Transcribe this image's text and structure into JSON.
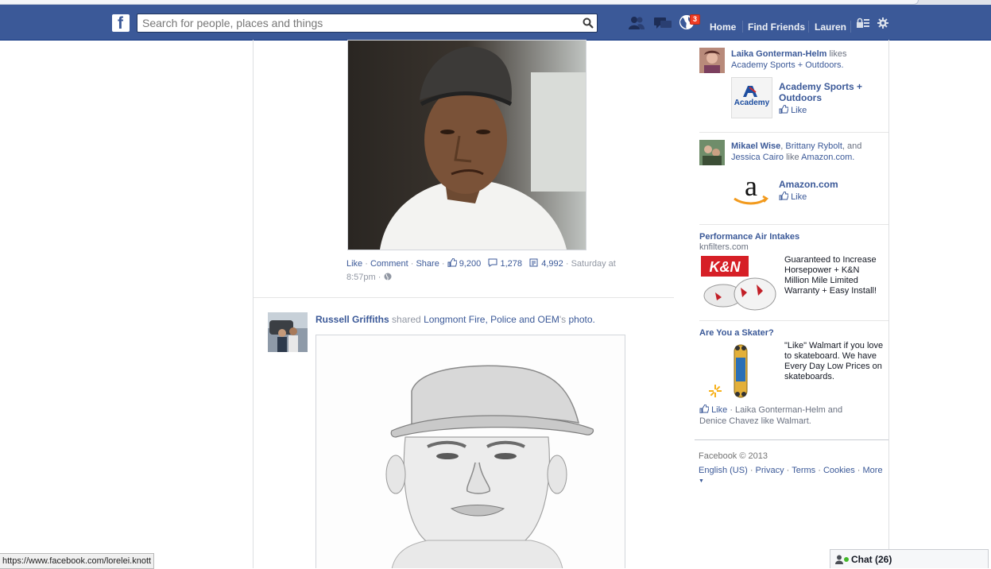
{
  "topbar": {
    "search_placeholder": "Search for people, places and things",
    "notifications_count": "3",
    "nav": {
      "home": "Home",
      "find_friends": "Find Friends",
      "profile": "Lauren"
    }
  },
  "story1": {
    "actions": {
      "like": "Like",
      "comment": "Comment",
      "share": "Share",
      "likes_count": "9,200",
      "comments_count": "1,278",
      "shares_count": "4,992",
      "time": "Saturday at 8:57pm"
    }
  },
  "story2": {
    "author": "Russell Griffiths",
    "verb": "shared",
    "page": "Longmont Fire, Police and OEM",
    "possessive": "'s",
    "object": "photo."
  },
  "sidebar": {
    "item1": {
      "name": "Laika Gonterman-Helm",
      "verb": "likes",
      "page": "Academy Sports + Outdoors.",
      "page_title": "Academy Sports + Outdoors",
      "thumb_text": "Academy",
      "like": "Like"
    },
    "item2": {
      "name": "Mikael Wise",
      "sep": ",",
      "name2": "Brittany Rybolt",
      "and": ", and",
      "name3": "Jessica Cairo",
      "verb": "like",
      "page": "Amazon.com.",
      "page_title": "Amazon.com",
      "like": "Like"
    },
    "ad1": {
      "title": "Performance Air Intakes",
      "url": "knfilters.com",
      "body": "Guaranteed to Increase Horsepower + K&N Million Mile Limited Warranty + Easy Install!"
    },
    "ad2": {
      "title": "Are You a Skater?",
      "body": "\"Like\" Walmart if you love to skateboard. We have Every Day Low Prices on skateboards.",
      "like": "Like",
      "social": "· Laika Gonterman-Helm and Denice Chavez like Walmart."
    },
    "footer": {
      "copyright": "Facebook © 2013",
      "links": [
        "English (US)",
        "Privacy",
        "Terms",
        "Cookies",
        "More"
      ]
    }
  },
  "status_url": "https://www.facebook.com/lorelei.knott",
  "chat": {
    "label": "Chat (26)"
  },
  "colors": {
    "brand_blue": "#3b5998",
    "badge_red": "#f03d25",
    "online_green": "#42b72a"
  }
}
